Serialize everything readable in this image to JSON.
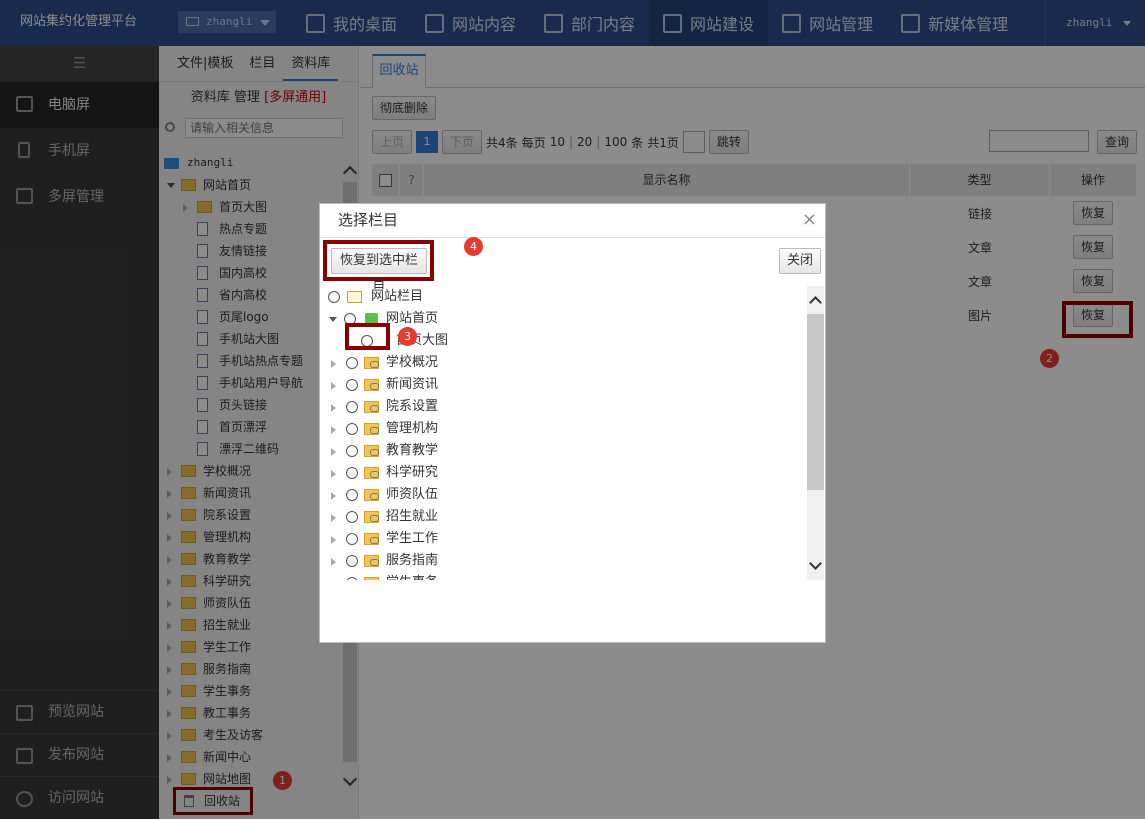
{
  "app": {
    "title": "网站集约化管理平台",
    "user": "zhangli"
  },
  "nav": [
    {
      "label": "我的桌面"
    },
    {
      "label": "网站内容"
    },
    {
      "label": "部门内容"
    },
    {
      "label": "网站建设"
    },
    {
      "label": "网站管理"
    },
    {
      "label": "新媒体管理"
    }
  ],
  "sidebar": {
    "items": [
      {
        "label": "电脑屏"
      },
      {
        "label": "手机屏"
      },
      {
        "label": "多屏管理"
      }
    ],
    "bottom": [
      {
        "label": "预览网站"
      },
      {
        "label": "发布网站"
      },
      {
        "label": "访问网站"
      }
    ]
  },
  "panel": {
    "tabs": [
      "文件|模板",
      "栏目",
      "资料库"
    ],
    "title_prefix": "资料库 管理",
    "title_tag": "[多屏通用]",
    "search_placeholder": "请输入相关信息",
    "tree": {
      "root": "zhangli",
      "home": "网站首页",
      "home_children": [
        "首页大图",
        "热点专题",
        "友情链接",
        "国内高校",
        "省内高校",
        "页尾logo",
        "手机站大图",
        "手机站热点专题",
        "手机站用户导航",
        "页头链接",
        "首页漂浮",
        "漂浮二维码"
      ],
      "others": [
        "学校概况",
        "新闻资讯",
        "院系设置",
        "管理机构",
        "教育教学",
        "科学研究",
        "师资队伍",
        "招生就业",
        "学生工作",
        "服务指南",
        "学生事务",
        "教工事务",
        "考生及访客",
        "新闻中心",
        "网站地图"
      ]
    },
    "recycle": "回收站"
  },
  "main": {
    "tab": "回收站",
    "delete_btn": "彻底删除",
    "pager": {
      "prev": "上页",
      "page": "1",
      "next": "下页",
      "total": "共4条",
      "per_page_label": "每页",
      "sizes": [
        "10",
        "20",
        "100"
      ],
      "unit": "条",
      "pages": "共1页",
      "jump": "跳转"
    },
    "search_btn": "查询",
    "columns": {
      "name": "显示名称",
      "type": "类型",
      "op": "操作"
    },
    "rows": [
      {
        "type": "链接",
        "action": "恢复"
      },
      {
        "type": "文章",
        "action": "恢复"
      },
      {
        "type": "文章",
        "action": "恢复"
      },
      {
        "type": "图片",
        "action": "恢复"
      }
    ]
  },
  "modal": {
    "title": "选择栏目",
    "restore_btn": "恢复到选中栏目",
    "close_btn": "关闭",
    "tree": {
      "root": "网站栏目",
      "home": "网站首页",
      "child": "首页大图",
      "items": [
        "学校概况",
        "新闻资讯",
        "院系设置",
        "管理机构",
        "教育教学",
        "科学研究",
        "师资队伍",
        "招生就业",
        "学生工作",
        "服务指南",
        "学生事务"
      ]
    }
  },
  "annotations": [
    "1",
    "2",
    "3",
    "4"
  ],
  "colors": {
    "topbar": "#2c4f8a",
    "accent": "#3a7bd5",
    "highlight": "#8b0000",
    "badge": "#e83b30"
  }
}
